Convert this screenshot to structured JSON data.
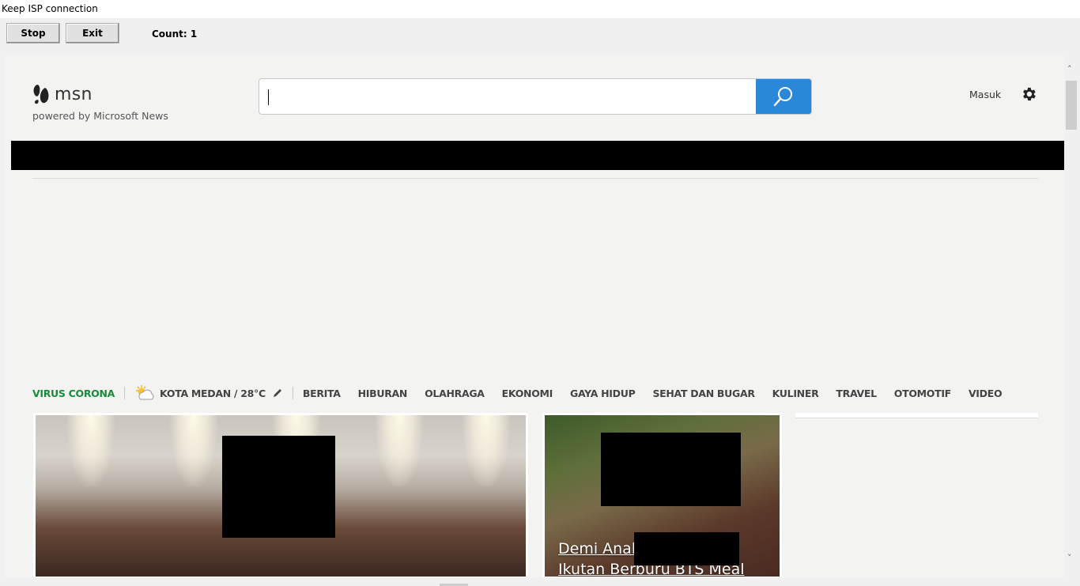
{
  "window": {
    "title": "Keep ISP connection"
  },
  "toolbar": {
    "stop_label": "Stop",
    "exit_label": "Exit",
    "count_text": "Count: 1"
  },
  "msn": {
    "logo_text": "msn",
    "tagline": "powered by Microsoft News",
    "search": {
      "value": "",
      "placeholder": ""
    },
    "signin_label": "Masuk",
    "icons": {
      "logo": "butterfly-icon",
      "search": "search-icon",
      "settings": "gear-icon"
    }
  },
  "nav": {
    "highlight": "VIRUS CORONA",
    "weather": "KOTA MEDAN / 28°C",
    "items": [
      "BERITA",
      "HIBURAN",
      "OLAHRAGA",
      "EKONOMI",
      "GAYA HIDUP",
      "SEHAT DAN BUGAR",
      "KULINER",
      "TRAVEL",
      "OTOMOTIF",
      "VIDEO"
    ]
  },
  "cards": {
    "secondary_headline_line1": "Demi Anak,",
    "secondary_headline_line2": "Ikutan Berburu BTS Meal"
  },
  "colors": {
    "accent": "#2b88d8",
    "corona": "#1b8a3c",
    "background": "#f3f3f2"
  }
}
